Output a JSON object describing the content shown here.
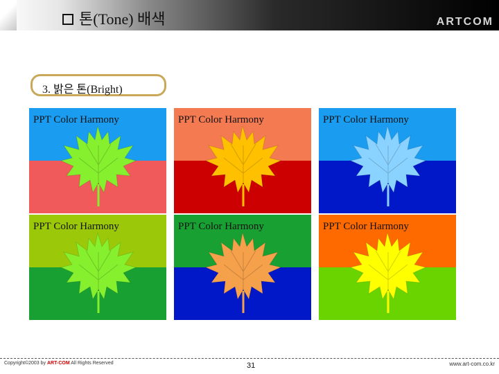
{
  "header": {
    "title": "톤(Tone) 배색",
    "brand": "ARTCOM"
  },
  "section": {
    "label": "3. 밝은 톤(Bright)"
  },
  "cards": [
    {
      "label": "PPT Color Harmony",
      "top": "#1a9cf0",
      "bottom": "#f05a5a",
      "leaf": "#86f02e"
    },
    {
      "label": "PPT Color Harmony",
      "top": "#f47a52",
      "bottom": "#cc0000",
      "leaf": "#ffc000"
    },
    {
      "label": "PPT Color Harmony",
      "top": "#1a9cf0",
      "bottom": "#0018c8",
      "leaf": "#8ad2ff"
    },
    {
      "label": "PPT Color Harmony",
      "top": "#9cc80a",
      "bottom": "#18a032",
      "leaf": "#86f02e"
    },
    {
      "label": "PPT Color Harmony",
      "top": "#18a032",
      "bottom": "#0018c8",
      "leaf": "#f5a04a"
    },
    {
      "label": "PPT Color Harmony",
      "top": "#ff6a00",
      "bottom": "#6ad400",
      "leaf": "#ffff00"
    }
  ],
  "footer": {
    "copyright_prefix": "Copyright©2003 by",
    "copyright_brand": "ART-COM",
    "copyright_suffix": "All Rights Reserved",
    "page_number": "31",
    "url": "www.art-com.co.kr"
  }
}
